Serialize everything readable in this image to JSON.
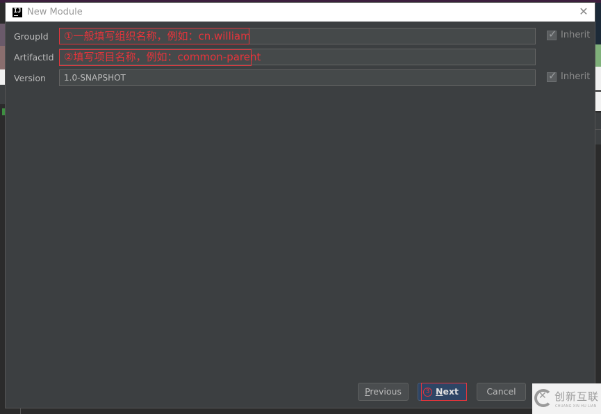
{
  "window": {
    "title": "New Module",
    "app_icon": "IJ",
    "close_glyph": "✕"
  },
  "form": {
    "group_id": {
      "label": "GroupId",
      "annotation": "①一般填写组织名称，例如：cn.william",
      "value": "",
      "inherit_label": "Inherit",
      "inherit_checked": true
    },
    "artifact_id": {
      "label": "ArtifactId",
      "annotation": "②填写项目名称，例如：common-parent",
      "value": ""
    },
    "version": {
      "label": "Version",
      "value": "1.0-SNAPSHOT",
      "inherit_label": "Inherit",
      "inherit_checked": true
    }
  },
  "buttons": {
    "previous": {
      "mnemonic": "P",
      "rest": "revious"
    },
    "next": {
      "step_marker": "③",
      "mnemonic": "N",
      "rest": "ext"
    },
    "cancel": {
      "label": "Cancel"
    }
  },
  "watermark": {
    "text": "创新互联",
    "subtext": "CHUANG XIN HU LIAN"
  },
  "colors": {
    "annotation_red": "#e8343b",
    "dialog_bg": "#3c3f41",
    "primary_button": "#2e4565"
  }
}
